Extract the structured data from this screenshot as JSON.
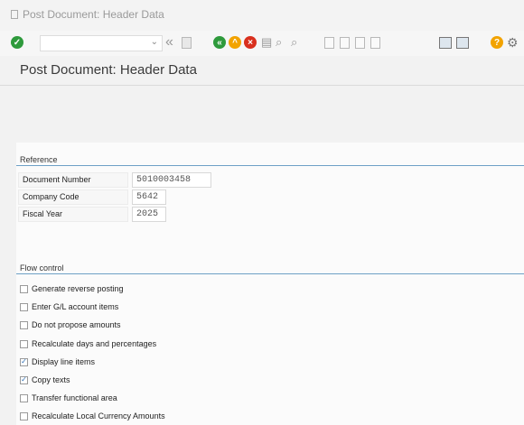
{
  "window": {
    "title": "Post Document: Header Data"
  },
  "toolbar": {
    "command_field_value": "",
    "icons": [
      "enter-icon",
      "back-icon",
      "save-icon",
      "back-green-icon",
      "exit-icon",
      "cancel-icon",
      "print-icon",
      "find-icon",
      "find-next-icon",
      "first-page-icon",
      "previous-page-icon",
      "next-page-icon",
      "last-page-icon",
      "create-session-icon",
      "shortcut-icon",
      "help-icon",
      "settings-icon"
    ]
  },
  "page": {
    "title": "Post Document: Header Data"
  },
  "reference": {
    "group_title": "Reference",
    "fields": [
      {
        "label": "Document Number",
        "value": "5010003458"
      },
      {
        "label": "Company Code",
        "value": "5642"
      },
      {
        "label": "Fiscal Year",
        "value": "2025"
      }
    ]
  },
  "flow_control": {
    "group_title": "Flow control",
    "options": [
      {
        "label": "Generate reverse posting",
        "checked": false
      },
      {
        "label": "Enter G/L account items",
        "checked": false
      },
      {
        "label": "Do not propose amounts",
        "checked": false
      },
      {
        "label": "Recalculate days and percentages",
        "checked": false
      },
      {
        "label": "Display line items",
        "checked": true
      },
      {
        "label": "Copy texts",
        "checked": true
      },
      {
        "label": "Transfer functional area",
        "checked": false
      },
      {
        "label": "Recalculate Local Currency Amounts",
        "checked": false
      }
    ]
  },
  "colors": {
    "accent": "#6ea0c6",
    "success": "#2e9a3c",
    "warning": "#f2a300",
    "error": "#d9301e"
  }
}
